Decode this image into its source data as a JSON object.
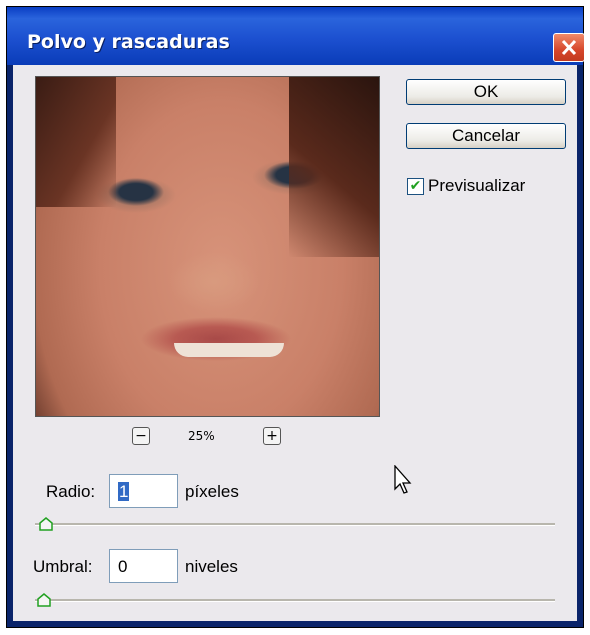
{
  "window": {
    "title": "Polvo y rascaduras"
  },
  "buttons": {
    "ok": "OK",
    "cancel": "Cancelar"
  },
  "preview_checkbox": {
    "label": "Previsualizar",
    "checked": true
  },
  "zoom": {
    "level": "25%",
    "zoom_out_symbol": "−",
    "zoom_in_symbol": "+"
  },
  "radius": {
    "label": "Radio:",
    "value": "1",
    "unit": "píxeles",
    "slider_value": 1
  },
  "threshold": {
    "label": "Umbral:",
    "value": "0",
    "unit": "niveles",
    "slider_value": 0
  },
  "icons": [
    "close-icon",
    "minus-icon",
    "plus-icon",
    "check-icon",
    "pointer-cursor-icon",
    "slider-thumb-icon"
  ],
  "colors": {
    "titlebar": "#1c50d0",
    "client_bg": "#ebe9ed",
    "close_button": "#d6462a",
    "check": "#21a121",
    "selection": "#316ac5"
  }
}
